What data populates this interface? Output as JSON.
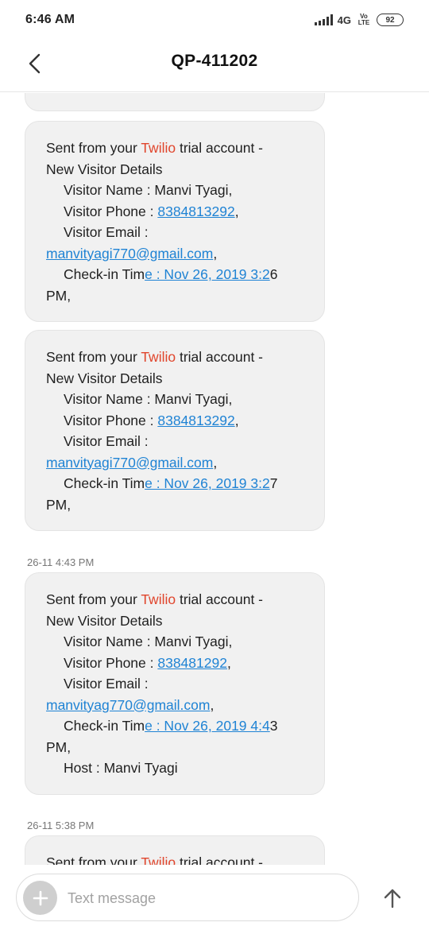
{
  "status_bar": {
    "time": "6:46 AM",
    "network": "4G",
    "volte": "Vo LTE",
    "battery": "92"
  },
  "header": {
    "back_icon": "chevron-left-icon",
    "title": "QP-411202"
  },
  "messages": [
    {
      "prefix": "Sent from your ",
      "brand": "Twilio",
      "suffix": " trial account -",
      "subject": "New Visitor Details",
      "name_line": "Visitor Name : Manvi Tyagi,",
      "phone_label": "Visitor Phone : ",
      "phone": "8384813292",
      "email_label": "Visitor Email :",
      "email": "manvityagi770@gmail.com",
      "checkin_text": "Check-in Tim",
      "checkin_link": "e : Nov 26, 2019 3:2",
      "checkin_tail": "6",
      "ampm": "PM,"
    },
    {
      "prefix": "Sent from your ",
      "brand": "Twilio",
      "suffix": " trial account -",
      "subject": "New Visitor Details",
      "name_line": "Visitor Name : Manvi Tyagi,",
      "phone_label": "Visitor Phone : ",
      "phone": "8384813292",
      "email_label": "Visitor Email :",
      "email": "manvityagi770@gmail.com",
      "checkin_text": "Check-in Tim",
      "checkin_link": "e : Nov 26, 2019 3:2",
      "checkin_tail": "7",
      "ampm": "PM,"
    },
    {
      "timestamp": "26-11 4:43 PM",
      "prefix": "Sent from your ",
      "brand": "Twilio",
      "suffix": " trial account -",
      "subject": "New Visitor Details",
      "name_line": "Visitor Name : Manvi Tyagi,",
      "phone_label": "Visitor Phone : ",
      "phone": "838481292",
      "email_label": "Visitor Email :",
      "email": "manvityag770@gmail.com",
      "checkin_text": "Check-in Tim",
      "checkin_link": "e : Nov 26, 2019 4:4",
      "checkin_tail": "3",
      "ampm": "PM,",
      "host_line": "Host : Manvi Tyagi"
    },
    {
      "timestamp": "26-11 5:38 PM",
      "prefix": "Sent from your ",
      "brand": "Twilio",
      "suffix": " trial account -"
    }
  ],
  "composer": {
    "add_icon": "plus-icon",
    "placeholder": "Text message",
    "send_icon": "arrow-up-icon"
  },
  "colors": {
    "brand": "#e0452c",
    "link": "#1f83d4",
    "bubble": "#f1f1f1"
  }
}
